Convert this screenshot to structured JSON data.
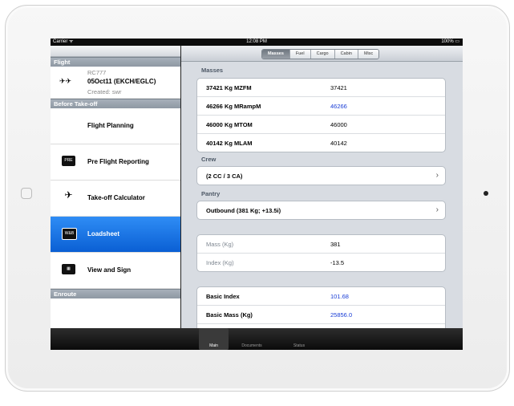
{
  "status_bar": {
    "carrier": "Carrier ᯤ",
    "time": "12:08 PM",
    "battery": "100% ▭"
  },
  "sidebar": {
    "flight_header": "Flight",
    "flight": {
      "number": "RC777",
      "route": "05Oct11 (EKCH/EGLC)",
      "created": "Created: swr",
      "icon": "plane-icons"
    },
    "before_takeoff_header": "Before Take-off",
    "items": [
      {
        "label": "Flight Planning",
        "icon": "",
        "selected": false
      },
      {
        "label": "Pre Flight Reporting",
        "icon": "PRE",
        "selected": false
      },
      {
        "label": "Take-off Calculator",
        "icon": "plane-icon",
        "selected": false
      },
      {
        "label": "Loadsheet",
        "icon": "W&B",
        "selected": true
      },
      {
        "label": "View and Sign",
        "icon": "table-icon",
        "selected": false
      }
    ],
    "enroute_header": "Enroute"
  },
  "segments": [
    "Masses",
    "Fuel",
    "Cargo",
    "Cabin",
    "Misc"
  ],
  "selected_segment": "Masses",
  "masses": {
    "label": "Masses",
    "rows": [
      {
        "key": "37421 Kg MZFM",
        "value": "37421"
      },
      {
        "key": "46266 Kg MRampM",
        "value": "46266"
      },
      {
        "key": "46000 Kg MTOM",
        "value": "46000"
      },
      {
        "key": "40142 Kg MLAM",
        "value": "40142"
      }
    ]
  },
  "crew": {
    "label": "Crew",
    "value": "(2 CC / 3 CA)"
  },
  "pantry": {
    "label": "Pantry",
    "value": "Outbound (381 Kg; +13.5i)"
  },
  "pantry_detail": [
    {
      "key": "Mass (Kg)",
      "value": "381"
    },
    {
      "key": "Index (Kg)",
      "value": "-13.5"
    }
  ],
  "basic": [
    {
      "key": "Basic Index",
      "value": "101.68"
    },
    {
      "key": "Basic Mass (Kg)",
      "value": "25856.0"
    }
  ],
  "tabs": [
    "Main",
    "Documents",
    "Status"
  ],
  "selected_tab": "Main",
  "colors": {
    "accent": "#0a5fd4",
    "value_blue": "#1a3ed6"
  }
}
